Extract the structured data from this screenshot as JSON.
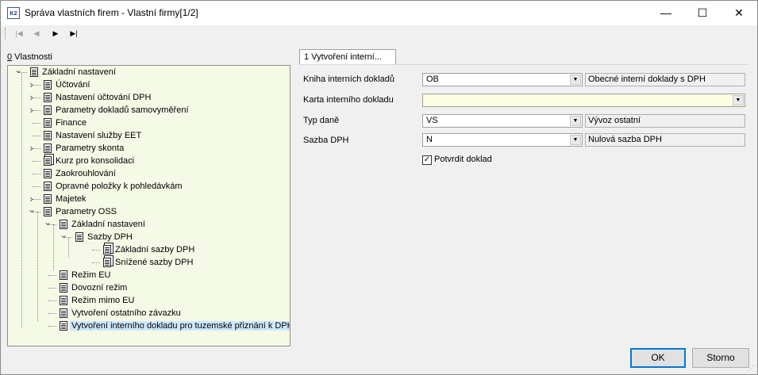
{
  "window": {
    "title": "Správa vlastních firem - Vlastní firmy[1/2]",
    "icon_text": "K2",
    "minimize": "—",
    "maximize": "☐",
    "close": "✕"
  },
  "toolbar": {
    "first": "|◀",
    "prev": "◀",
    "next": "▶",
    "last": "▶|"
  },
  "panel": {
    "label_hotkey": "0",
    "label_rest": " Vlastnosti"
  },
  "tree": [
    {
      "label": "Základní nastavení",
      "chev": "down"
    },
    {
      "label": "Účtování",
      "chev": "right"
    },
    {
      "label": "Nastavení účtování DPH",
      "chev": "right"
    },
    {
      "label": "Parametry dokladů samovyměření",
      "chev": "right"
    },
    {
      "label": "Finance",
      "chev": ""
    },
    {
      "label": "Nastavení služby EET",
      "chev": ""
    },
    {
      "label": "Parametry skonta",
      "chev": "right"
    },
    {
      "label": "Kurz pro konsolidaci",
      "chev": ""
    },
    {
      "label": "Zaokrouhlování",
      "chev": ""
    },
    {
      "label": "Opravné položky k pohledávkám",
      "chev": ""
    },
    {
      "label": "Majetek",
      "chev": "right"
    },
    {
      "label": "Parametry OSS",
      "chev": "down"
    },
    {
      "label": "Základní nastavení",
      "chev": "down"
    },
    {
      "label": "Sazby DPH",
      "chev": "down"
    },
    {
      "label": "Základní sazby DPH",
      "chev": ""
    },
    {
      "label": "Snížené sazby DPH",
      "chev": ""
    },
    {
      "label": "Režim EU",
      "chev": ""
    },
    {
      "label": "Dovozní režim",
      "chev": ""
    },
    {
      "label": "Režim mimo EU",
      "chev": ""
    },
    {
      "label": "Vytvoření ostatního závazku",
      "chev": ""
    },
    {
      "label": "Vytvoření interního dokladu pro tuzemské přiznání k DPH",
      "chev": ""
    }
  ],
  "tab": {
    "label": "1 Vytvoření interní..."
  },
  "fields": {
    "kniha": {
      "label": "Kniha interních dokladů",
      "value": "OB",
      "desc": "Obecné interní doklady s DPH"
    },
    "karta": {
      "label": "Karta interního dokladu",
      "value": ""
    },
    "typ": {
      "label": "Typ daně",
      "value": "VS",
      "desc": "Vývoz ostatní"
    },
    "sazba": {
      "label": "Sazba DPH",
      "value": "N",
      "desc": "Nulová sazba DPH"
    },
    "potvrdit": {
      "label": "Potvrdit doklad",
      "checked": "✓"
    }
  },
  "buttons": {
    "ok": "OK",
    "cancel": "Storno"
  },
  "dropdown_arrow": "▼",
  "resize_grip": "⋰"
}
